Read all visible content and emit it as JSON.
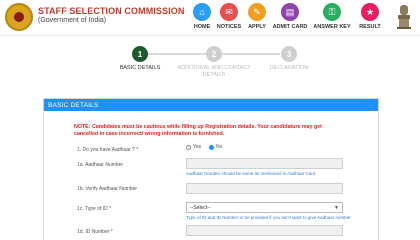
{
  "header": {
    "org_title": "STAFF SELECTION COMMISSION",
    "org_sub": "(Government of India)",
    "nav": [
      {
        "label": "HOME",
        "icon": "home-icon",
        "color": "#2a9df4",
        "glyph": "⌂"
      },
      {
        "label": "NOTICES",
        "icon": "notices-icon",
        "color": "#e84e4e",
        "glyph": "✉"
      },
      {
        "label": "APPLY",
        "icon": "apply-icon",
        "color": "#f0a020",
        "glyph": "✎"
      },
      {
        "label": "ADMIT CARD",
        "icon": "admit-card-icon",
        "color": "#8e44ad",
        "glyph": "▤"
      },
      {
        "label": "ANSWER KEY",
        "icon": "answer-key-icon",
        "color": "#27ae60",
        "glyph": "⚿"
      },
      {
        "label": "RESULT",
        "icon": "result-icon",
        "color": "#e91e63",
        "glyph": "★"
      }
    ]
  },
  "stepper": {
    "steps": [
      {
        "num": "1",
        "label": "BASIC DETAILS",
        "active": true
      },
      {
        "num": "2",
        "label": "ADDITIONAL AND CONTACT DETAILS",
        "active": false
      },
      {
        "num": "3",
        "label": "DECLARATION",
        "active": false
      }
    ]
  },
  "panel": {
    "title": "BASIC DETAILS",
    "note": "NOTE: Candidates must be cautious while filling up Registration details. Your candidature may get cancelled in case incorrect/ wrong information is furnished.",
    "q1_label": "1. Do you have Aadhaar ? *",
    "q1_yes": "Yes",
    "q1_no": "No",
    "q1_selected": "No",
    "q1a_label": "1a. Aadhaar Number",
    "q1a_hint": "Aadhaar Number should be same as mentioned in Aadhaar Card",
    "q1b_label": "1b. Verify Aadhaar Number",
    "q1c_label": "1c. Type of ID *",
    "q1c_value": "--Select--",
    "q1c_hint": "Type of ID and ID Number to be provided if you don't want to give Aadhaar number",
    "q1d_label": "1d. ID Number *"
  }
}
